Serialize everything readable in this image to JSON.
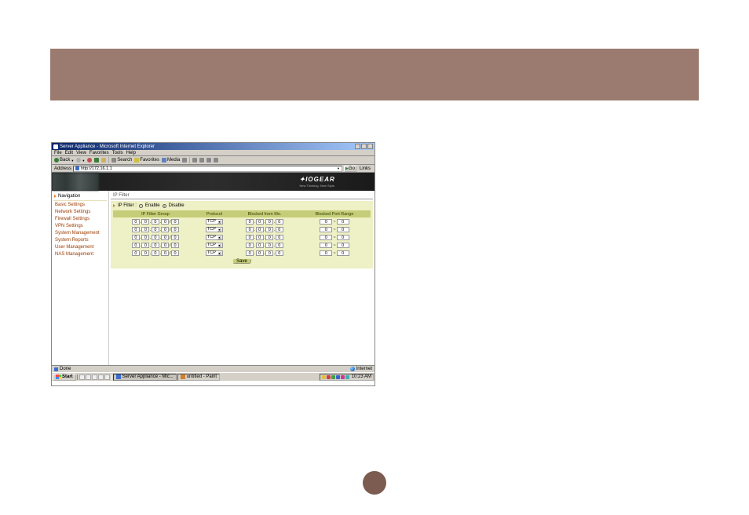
{
  "window": {
    "title": "Server Appliance - Microsoft Internet Explorer",
    "menus": [
      "File",
      "Edit",
      "View",
      "Favorites",
      "Tools",
      "Help"
    ],
    "tools": {
      "back": "Back",
      "search": "Search",
      "favorites": "Favorites",
      "media": "Media"
    },
    "address_label": "Address",
    "url": "http://172.16.1.1",
    "go_label": "Go",
    "links_label": "Links"
  },
  "brand": {
    "name": "IOGEAR",
    "tagline": "New Thinking. New Style."
  },
  "nav": {
    "heading": "Navigation",
    "items": [
      "Basic Settings",
      "Network Settings",
      "Firewall Settings",
      "VPN Settings",
      "System Management",
      "System Reports",
      "User Management",
      "NAS Management"
    ]
  },
  "breadcrumb": "IP Filter",
  "panel": {
    "title": "IP Filter :",
    "enable_label": "Enable",
    "disable_label": "Disable",
    "cols": [
      "IP Filter Group",
      "Protocol",
      "Blocked from Mo.",
      "Blocked Port Range"
    ],
    "protocol_value": "TCP",
    "octet_value": "0",
    "port_value": "0",
    "row_count": 5,
    "save_label": "Save"
  },
  "status": {
    "done_label": "Done",
    "zone_label": "Internet"
  },
  "taskbar": {
    "start_label": "Start",
    "tasks": [
      "Server Appliance - Mic...",
      "untitled - Paint"
    ],
    "clock": "10:23 AM"
  },
  "tray_colors": [
    "#e0c040",
    "#d04040",
    "#40a040",
    "#4060d0",
    "#c04090",
    "#40b0b0"
  ]
}
